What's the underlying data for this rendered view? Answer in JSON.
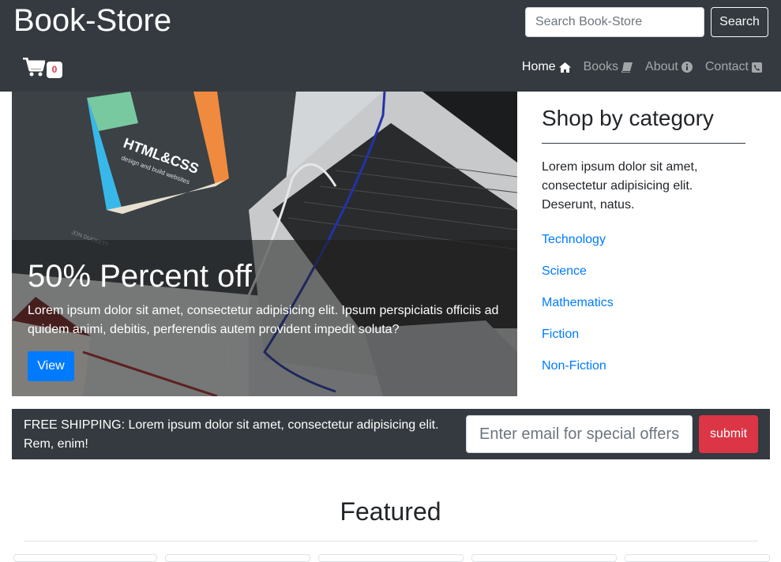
{
  "header": {
    "brand": "Book-Store",
    "search_placeholder": "Search Book-Store",
    "search_button": "Search",
    "cart_count": "0",
    "nav": [
      {
        "label": "Home",
        "icon": "home-icon",
        "active": true
      },
      {
        "label": "Books",
        "icon": "book-icon",
        "active": false
      },
      {
        "label": "About",
        "icon": "info-circle-icon",
        "active": false
      },
      {
        "label": "Contact",
        "icon": "phone-square-icon",
        "active": false
      }
    ]
  },
  "hero": {
    "title": "50% Percent off",
    "text": "Lorem ipsum dolor sit amet, consectetur adipisicing elit. Ipsum perspiciatis officiis ad quidem animi, debitis, perferendis autem provident impedit soluta?",
    "button": "View",
    "book_title": "HTML&CSS",
    "book_subtitle": "design and build websites",
    "book_author": "JON DUCKETT"
  },
  "sidebar": {
    "title": "Shop by category",
    "text": "Lorem ipsum dolor sit amet, consectetur adipisicing elit. Deserunt, natus.",
    "categories": [
      "Technology",
      "Science",
      "Mathematics",
      "Fiction",
      "Non-Fiction"
    ]
  },
  "shipping": {
    "text": "FREE SHIPPING: Lorem ipsum dolor sit amet, consectetur adipisicing elit. Rem, enim!",
    "email_placeholder": "Enter email for special offers",
    "submit": "submit"
  },
  "featured": {
    "title": "Featured"
  },
  "colors": {
    "navbar": "#343a40",
    "primary": "#007bff",
    "danger": "#dc3545",
    "white": "#ffffff"
  }
}
